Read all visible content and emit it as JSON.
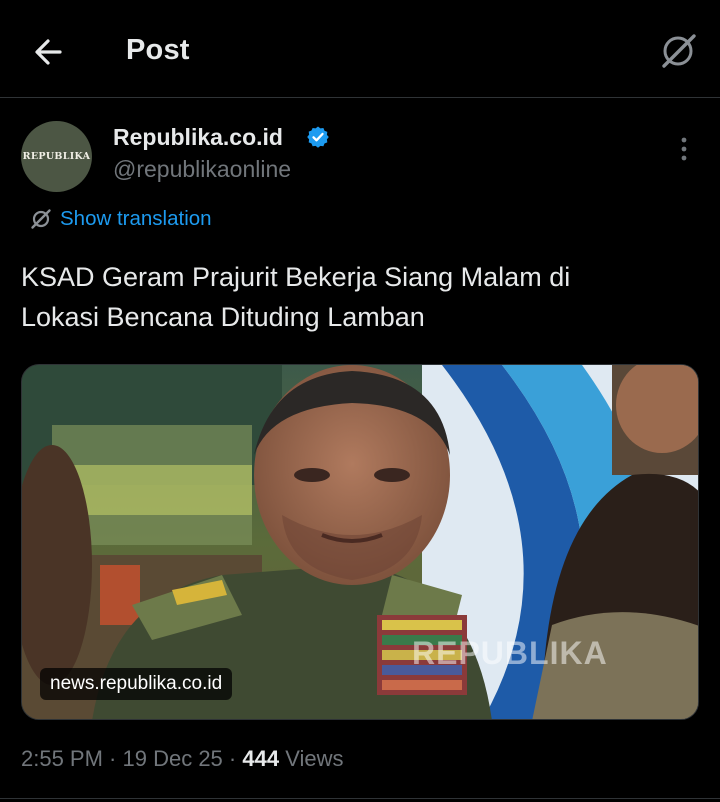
{
  "header": {
    "title": "Post",
    "back_icon": "arrow-left-icon",
    "grok_icon": "grok-icon"
  },
  "author": {
    "avatar_text": "REPUBLIKA",
    "display_name": "Republika.co.id",
    "handle": "@republikaonline",
    "verified": true,
    "verified_color": "#1d9bf0"
  },
  "translate": {
    "label": "Show translation",
    "icon": "grok-translate-icon"
  },
  "post": {
    "line1": "KSAD Geram Prajurit Bekerja Siang Malam di",
    "line2": "Lokasi Bencana Dituding Lamban",
    "link_domain": "news.republika.co.id",
    "watermark": "REPUBLIKA"
  },
  "meta": {
    "time": "2:55 PM",
    "sep1": " · ",
    "date": "19 Dec 25",
    "sep2": " · ",
    "views_count": "444",
    "views_label": " Views"
  },
  "colors": {
    "accent": "#1d9bf0",
    "muted": "#71767b",
    "text": "#e7e9ea",
    "background": "#000000"
  }
}
